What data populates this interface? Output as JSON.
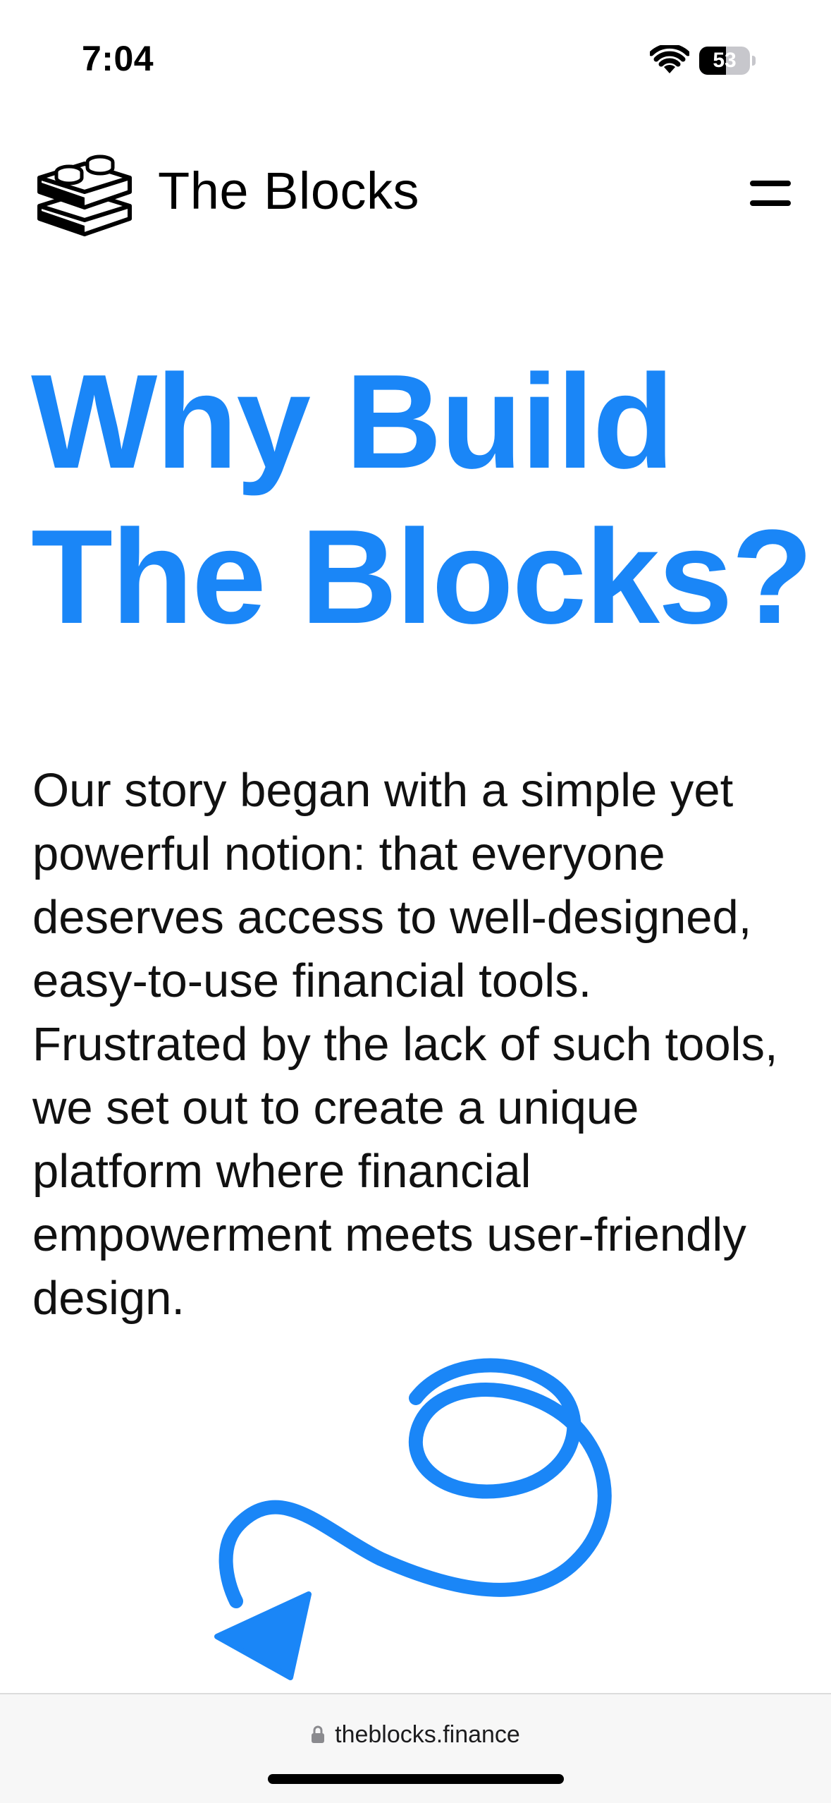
{
  "status_bar": {
    "time": "7:04",
    "battery_level": "53",
    "battery_fraction": 0.53,
    "wifi_icon": "wifi-icon"
  },
  "header": {
    "brand_name": "The Blocks",
    "logo_icon": "lego-bricks-icon",
    "menu_icon": "hamburger-menu-icon"
  },
  "hero": {
    "title_line1": "Why Build",
    "title_line2": "The Blocks?",
    "story": "Our story began with a simple yet powerful notion: that everyone deserves access to well-designed, easy-to-use financial tools. Frustrated by the lack of such tools, we set out to create a unique platform where financial empowerment meets user-friendly design.",
    "decoration_icon": "swirl-arrow-icon"
  },
  "browser": {
    "url": "theblocks.finance",
    "lock_icon": "lock-icon"
  },
  "colors": {
    "accent": "#1a86f7",
    "text": "#111111",
    "background": "#ffffff"
  }
}
